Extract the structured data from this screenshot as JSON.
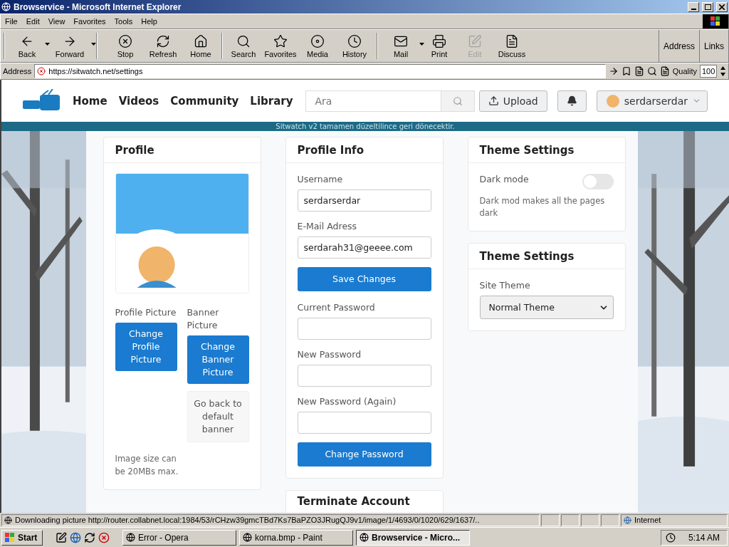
{
  "window": {
    "title": "Browservice - Microsoft Internet Explorer"
  },
  "menu": [
    "File",
    "Edit",
    "View",
    "Favorites",
    "Tools",
    "Help"
  ],
  "toolbar": [
    {
      "label": "Back",
      "dropdown": true,
      "disabled": false
    },
    {
      "label": "Forward",
      "dropdown": true,
      "disabled": false
    },
    {
      "label": "Stop",
      "dropdown": false,
      "disabled": false
    },
    {
      "label": "Refresh",
      "dropdown": false,
      "disabled": false
    },
    {
      "label": "Home",
      "dropdown": false,
      "disabled": false
    },
    {
      "label": "Search",
      "dropdown": false,
      "disabled": false
    },
    {
      "label": "Favorites",
      "dropdown": false,
      "disabled": false
    },
    {
      "label": "Media",
      "dropdown": false,
      "disabled": false
    },
    {
      "label": "History",
      "dropdown": false,
      "disabled": false
    },
    {
      "label": "Mail",
      "dropdown": true,
      "disabled": false
    },
    {
      "label": "Print",
      "dropdown": false,
      "disabled": false
    },
    {
      "label": "Edit",
      "dropdown": false,
      "disabled": true
    },
    {
      "label": "Discuss",
      "dropdown": false,
      "disabled": false
    }
  ],
  "toolbar_right": [
    "Address",
    "Links"
  ],
  "address_bar": {
    "label": "Address",
    "url": "https://sitwatch.net/settings",
    "quality_label": "Quality",
    "quality_value": "100"
  },
  "site": {
    "nav": [
      "Home",
      "Videos",
      "Community",
      "Library"
    ],
    "search": {
      "placeholder": "Ara"
    },
    "upload": "Upload",
    "user": "serdarserdar",
    "announcement": "Sitwatch v2 tamamen düzeltilince geri dönecektir."
  },
  "profile": {
    "title": "Profile",
    "profile_label": "Profile Picture",
    "banner_label": "Banner Picture",
    "change_profile": "Change Profile Picture",
    "change_banner": "Change Banner Picture",
    "default_banner": "Go back to default banner",
    "note": "Image size can be 20MBs max."
  },
  "profile_info": {
    "title": "Profile Info",
    "fields": [
      {
        "label": "Username",
        "value": "serdarserdar"
      },
      {
        "label": "E-Mail Adress",
        "value": "serdarah31@geeee.com"
      }
    ],
    "save": "Save Changes",
    "password_fields": [
      {
        "label": "Current Password"
      },
      {
        "label": "New Password"
      },
      {
        "label": "New Password (Again)"
      }
    ],
    "change_password": "Change Password"
  },
  "terminate": {
    "title": "Terminate Account"
  },
  "theme_mode": {
    "title": "Theme Settings",
    "label": "Dark mode",
    "on": false,
    "description": "Dark mod makes all the pages dark"
  },
  "theme_select": {
    "title": "Theme Settings",
    "label": "Site Theme",
    "value": "Normal Theme"
  },
  "status_bar": {
    "text": "Downloading picture http://router.collabnet.local:1984/53/rCHzw39gmcTBd7Ks7BaPZO3JRugQJ9v1/image/1/4693/0/1020/629/1637/..",
    "zone": "Internet"
  },
  "taskbar": {
    "start": "Start",
    "tasks": [
      {
        "label": "Error - Opera",
        "selected": false
      },
      {
        "label": "korna.bmp - Paint",
        "selected": false
      },
      {
        "label": "Browservice - Micro...",
        "selected": true
      }
    ],
    "clock": "5:14 AM"
  }
}
